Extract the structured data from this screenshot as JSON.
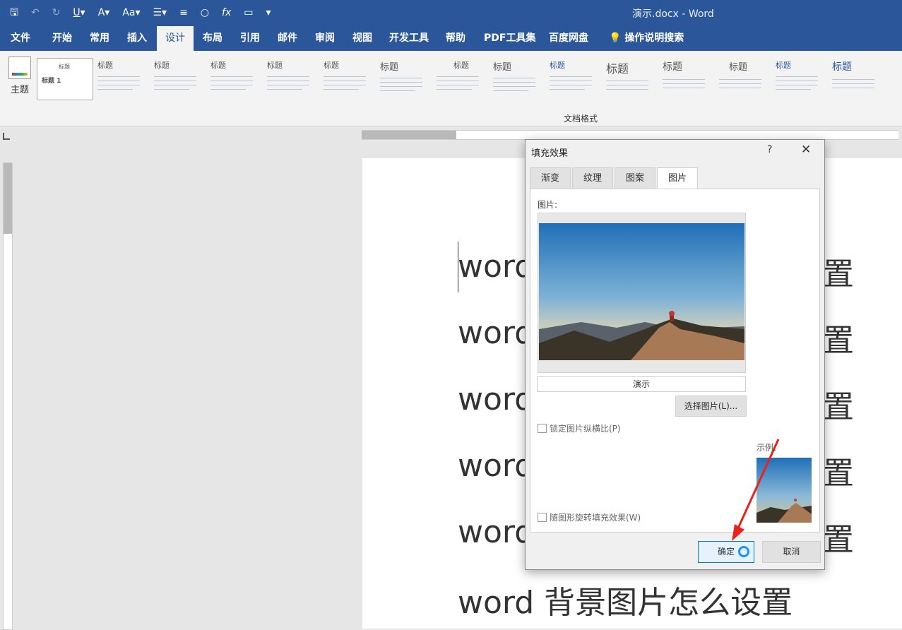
{
  "window": {
    "title": "演示.docx - Word"
  },
  "quick_access": [
    "save-icon",
    "undo-icon",
    "redo-icon",
    "underline-icon",
    "font-color-icon",
    "font-size-icon",
    "bullets-icon",
    "align-icon",
    "shape-icon",
    "formula-icon",
    "screen-icon",
    "more-icon"
  ],
  "menu": {
    "tabs": [
      "文件",
      "开始",
      "常用",
      "插入",
      "设计",
      "布局",
      "引用",
      "邮件",
      "审阅",
      "视图",
      "开发工具",
      "帮助",
      "PDF工具集",
      "百度网盘"
    ],
    "active": "设计",
    "search": "操作说明搜索"
  },
  "ribbon": {
    "theme_label": "主题",
    "group_label": "文档格式",
    "styles": [
      "标题",
      "标题",
      "标题",
      "标题",
      "标题",
      "标题",
      "标题",
      "标题",
      "标题",
      "标题",
      "标题",
      "标题",
      "标题",
      "标题",
      "标题"
    ],
    "first_style_title": "标题 1"
  },
  "document": {
    "lines": [
      "word",
      "word",
      "word",
      "word",
      "word",
      "word 背景图片怎么设置"
    ],
    "line_end": "置"
  },
  "dialog": {
    "title": "填充效果",
    "help": "?",
    "close": "✕",
    "tabs": [
      "渐变",
      "纹理",
      "图案",
      "图片"
    ],
    "active_tab": "图片",
    "picture_label": "图片:",
    "picture_name": "演示",
    "choose_button": "选择图片(L)...",
    "lock_aspect": "锁定图片纵横比(P)",
    "rotate_with_shape": "随图形旋转填充效果(W)",
    "preview_label": "示例:",
    "ok": "确定",
    "cancel": "取消"
  },
  "colors": {
    "brand": "#2b579a",
    "accent": "#0078d7",
    "arrow": "#e8231a"
  }
}
